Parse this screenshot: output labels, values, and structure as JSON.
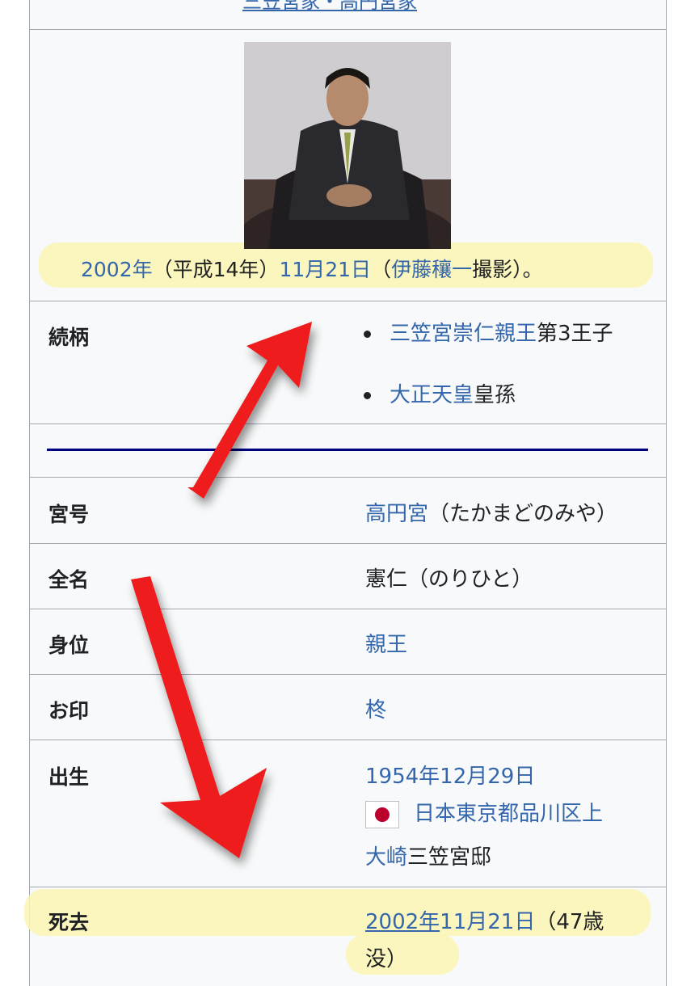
{
  "top_link": "三笠宮家・高円宮家",
  "caption": {
    "year_link": "2002年",
    "era": "（平成14年）",
    "date_link": "11月21日",
    "open_paren": "（",
    "photographer_link": "伊藤穰一",
    "suffix": "撮影）。"
  },
  "rows": {
    "lineage": {
      "label": "続柄",
      "items": [
        {
          "link": "三笠宮崇仁親王",
          "text": "第3王子"
        },
        {
          "link": "大正天皇",
          "text": "皇孫"
        }
      ]
    },
    "miyago": {
      "label": "宮号",
      "link": "高円宮",
      "text": "（たかまどのみや）"
    },
    "fullname": {
      "label": "全名",
      "text": "憲仁（のりひと）"
    },
    "rank": {
      "label": "身位",
      "link": "親王"
    },
    "seal": {
      "label": "お印",
      "link": "柊"
    },
    "birth": {
      "label": "出生",
      "date_link": "1954年12月29日",
      "place_link_1": "日本東京都品川区上",
      "place_link_2": "大崎",
      "place_text": "三笠宮邸"
    },
    "death": {
      "label": "死去",
      "year_link": "2002年",
      "date_link": "11月21日",
      "age_1": "（47歳",
      "age_2": "没）"
    }
  },
  "icons": [
    "japan-flag-icon",
    "red-arrow-up",
    "red-arrow-down"
  ],
  "colors": {
    "link": "#3366aa",
    "highlight": "#fbf6b3",
    "arrow": "#ee1111",
    "rule": "#000080"
  }
}
